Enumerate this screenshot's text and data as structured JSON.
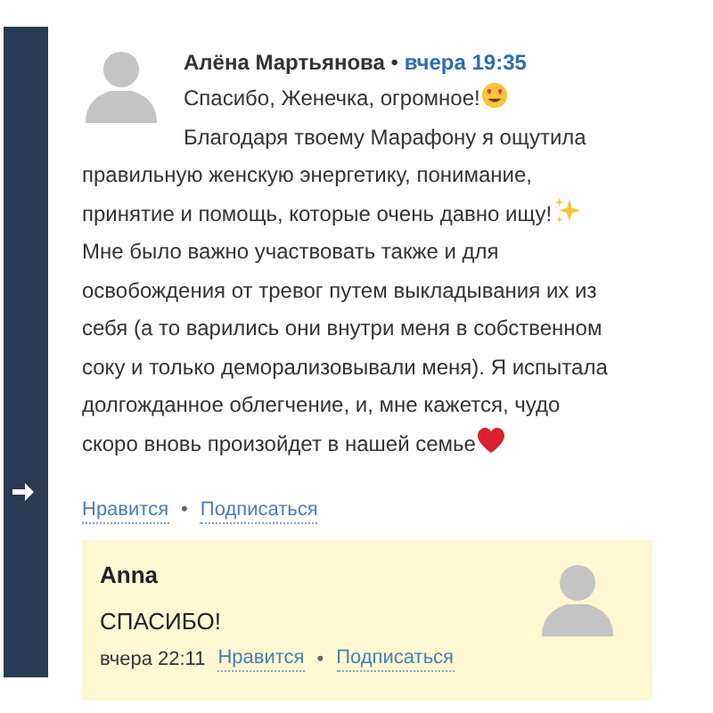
{
  "comment": {
    "author": "Алёна Мартьянова",
    "separator": "•",
    "time": "вчера 19:35",
    "lines": [
      [
        {
          "kind": "text",
          "text": "Спасибо, Женечка, огромное!"
        },
        {
          "kind": "smiley"
        }
      ],
      [
        {
          "kind": "text",
          "text": "Благодаря твоему Марафону я ощутила"
        }
      ],
      [
        {
          "kind": "text",
          "text": "правильную женскую энергетику, понимание,"
        }
      ],
      [
        {
          "kind": "text",
          "text": "принятие и помощь, которые очень давно ищу!"
        },
        {
          "kind": "sparkles"
        }
      ],
      [
        {
          "kind": "text",
          "text": "Мне было важно участвовать также и для"
        }
      ],
      [
        {
          "kind": "text",
          "text": "освобождения от тревог путем выкладывания их из"
        }
      ],
      [
        {
          "kind": "text",
          "text": "себя (а то варились они внутри меня в собственном"
        }
      ],
      [
        {
          "kind": "text",
          "text": "соку и только деморализовывали меня). Я испытала"
        }
      ],
      [
        {
          "kind": "text",
          "text": "долгожданное облегчение, и, мне кажется, чудо"
        }
      ],
      [
        {
          "kind": "text",
          "text": "скоро вновь произойдет в нашей семье"
        },
        {
          "kind": "heart"
        }
      ]
    ],
    "actions": [
      {
        "kind": "link",
        "text": "Нравится"
      },
      {
        "kind": "dot",
        "text": "•"
      },
      {
        "kind": "link",
        "text": "Подписаться"
      }
    ]
  },
  "reply": {
    "author": "Anna",
    "text": "СПАСИБО!",
    "time": "вчера 22:11",
    "actions": [
      {
        "kind": "link",
        "text": "Нравится"
      },
      {
        "kind": "dot",
        "text": "•"
      },
      {
        "kind": "link",
        "text": "Подписаться"
      }
    ]
  }
}
